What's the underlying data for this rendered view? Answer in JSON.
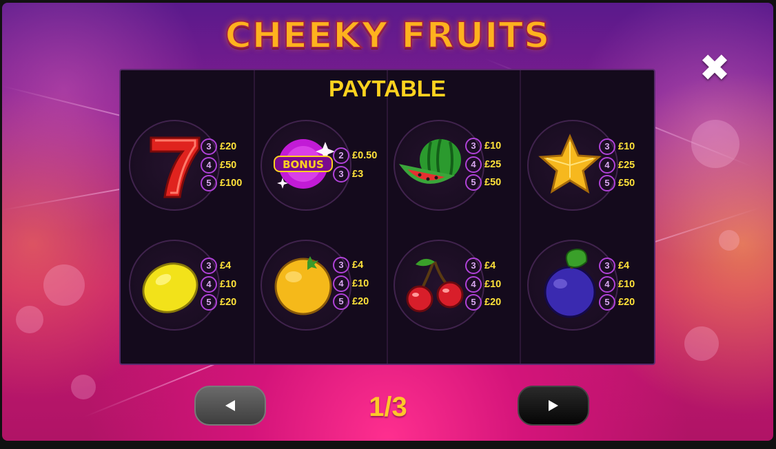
{
  "game": {
    "title": "CHEEKY FRUITS"
  },
  "paytable": {
    "title": "PAYTABLE",
    "symbols": [
      {
        "icon": "seven-icon",
        "pays": [
          {
            "count": "3",
            "amount": "£20"
          },
          {
            "count": "4",
            "amount": "£50"
          },
          {
            "count": "5",
            "amount": "£100"
          }
        ]
      },
      {
        "icon": "bonus-icon",
        "label": "BONUS",
        "pays": [
          {
            "count": "2",
            "amount": "£0.50"
          },
          {
            "count": "3",
            "amount": "£3"
          }
        ]
      },
      {
        "icon": "watermelon-icon",
        "pays": [
          {
            "count": "3",
            "amount": "£10"
          },
          {
            "count": "4",
            "amount": "£25"
          },
          {
            "count": "5",
            "amount": "£50"
          }
        ]
      },
      {
        "icon": "star-icon",
        "pays": [
          {
            "count": "3",
            "amount": "£10"
          },
          {
            "count": "4",
            "amount": "£25"
          },
          {
            "count": "5",
            "amount": "£50"
          }
        ]
      },
      {
        "icon": "lemon-icon",
        "pays": [
          {
            "count": "3",
            "amount": "£4"
          },
          {
            "count": "4",
            "amount": "£10"
          },
          {
            "count": "5",
            "amount": "£20"
          }
        ]
      },
      {
        "icon": "orange-icon",
        "pays": [
          {
            "count": "3",
            "amount": "£4"
          },
          {
            "count": "4",
            "amount": "£10"
          },
          {
            "count": "5",
            "amount": "£20"
          }
        ]
      },
      {
        "icon": "cherry-icon",
        "pays": [
          {
            "count": "3",
            "amount": "£4"
          },
          {
            "count": "4",
            "amount": "£10"
          },
          {
            "count": "5",
            "amount": "£20"
          }
        ]
      },
      {
        "icon": "plum-icon",
        "pays": [
          {
            "count": "3",
            "amount": "£4"
          },
          {
            "count": "4",
            "amount": "£10"
          },
          {
            "count": "5",
            "amount": "£20"
          }
        ]
      }
    ]
  },
  "navigation": {
    "page_indicator": "1/3",
    "prev_icon": "triangle-left-icon",
    "next_icon": "triangle-right-icon",
    "close_icon": "close-x-icon"
  },
  "colors": {
    "title": "#ffb21e",
    "panel_title": "#ffd21f",
    "amount": "#ffe23a",
    "count_ring": "#b042d8",
    "panel_bg": "#140a1c"
  }
}
